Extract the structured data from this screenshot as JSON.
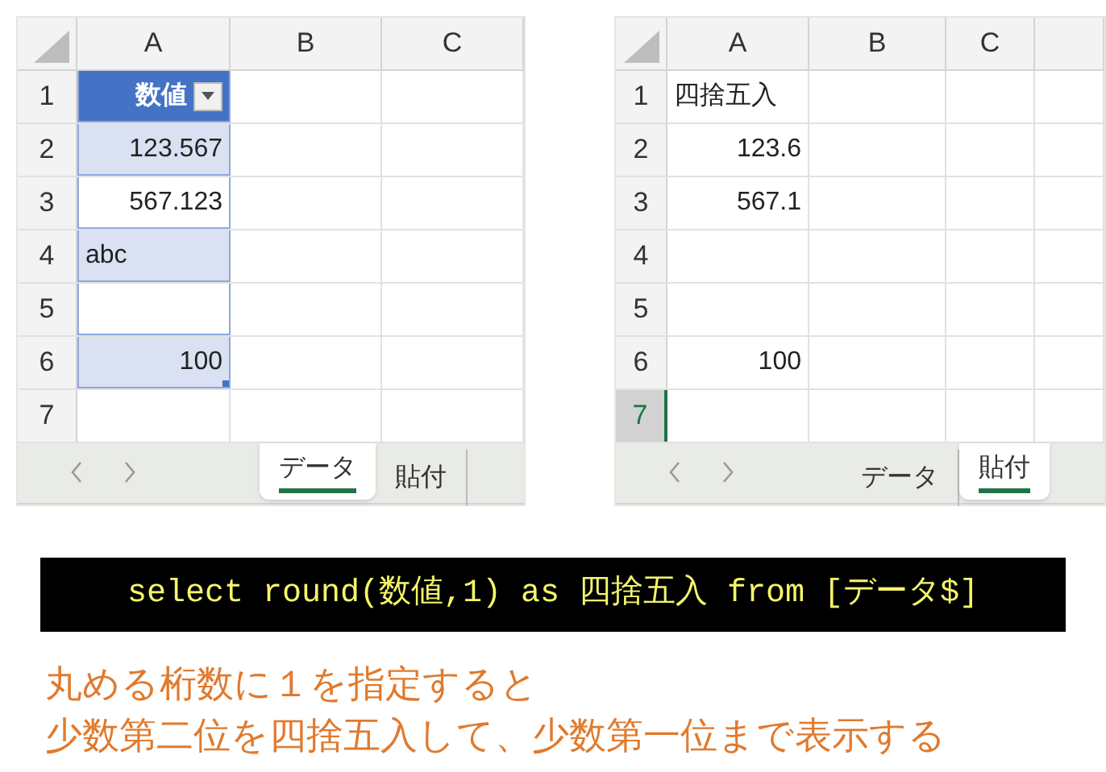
{
  "sheets": [
    {
      "columns": [
        {
          "label": "A"
        },
        {
          "label": "B"
        },
        {
          "label": "C"
        }
      ],
      "rows": [
        {
          "label": "1",
          "selected": false,
          "cell": {
            "text": "数値",
            "kind": "header",
            "filter": true
          }
        },
        {
          "label": "2",
          "selected": false,
          "cell": {
            "text": "123.567",
            "kind": "bandnumber"
          }
        },
        {
          "label": "3",
          "selected": false,
          "cell": {
            "text": "567.123",
            "kind": "tablenumber"
          }
        },
        {
          "label": "4",
          "selected": false,
          "cell": {
            "text": "abc",
            "kind": "bandtext"
          }
        },
        {
          "label": "5",
          "selected": false,
          "cell": {
            "kind": "tablenumber"
          }
        },
        {
          "label": "6",
          "selected": false,
          "cell": {
            "text": "100",
            "kind": "bandnumber",
            "resize": true
          }
        },
        {
          "label": "7",
          "selected": false,
          "cell": {
            "kind": "number"
          }
        }
      ],
      "tabs": [
        {
          "label": "データ",
          "selected": true
        },
        {
          "label": "貼付",
          "selected": false
        }
      ]
    },
    {
      "columns": [
        {
          "label": "A"
        },
        {
          "label": "B"
        },
        {
          "label": "C"
        }
      ],
      "rows": [
        {
          "label": "1",
          "selected": false,
          "cell": {
            "text": "四捨五入",
            "kind": "text"
          }
        },
        {
          "label": "2",
          "selected": false,
          "cell": {
            "text": "123.6",
            "kind": "number"
          }
        },
        {
          "label": "3",
          "selected": false,
          "cell": {
            "text": "567.1",
            "kind": "number"
          }
        },
        {
          "label": "4",
          "selected": false,
          "cell": {
            "kind": "number"
          }
        },
        {
          "label": "5",
          "selected": false,
          "cell": {
            "kind": "number"
          }
        },
        {
          "label": "6",
          "selected": false,
          "cell": {
            "text": "100",
            "kind": "number"
          }
        },
        {
          "label": "7",
          "selected": true,
          "cell": {
            "kind": "number"
          }
        }
      ],
      "tabs": [
        {
          "label": "データ",
          "selected": false
        },
        {
          "label": "貼付",
          "selected": true
        }
      ]
    }
  ],
  "query": "select round(数値,1) as 四捨五入 from [データ$]",
  "explanation": [
    "丸める桁数に１を指定すると",
    "少数第二位を四捨五入して、少数第一位まで表示する"
  ]
}
